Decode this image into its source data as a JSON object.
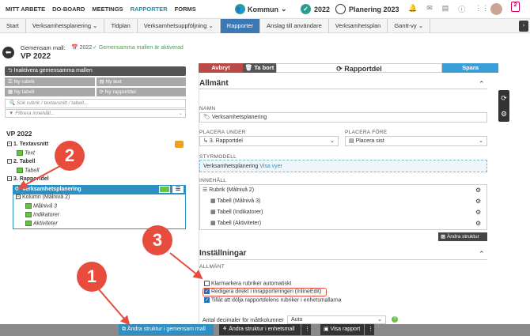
{
  "topnav": {
    "items": [
      "MITT ARBETE",
      "DO-BOARD",
      "MEETINGS",
      "RAPPORTER",
      "FORMS"
    ],
    "kommun": "Kommun",
    "year": "2022",
    "plan": "Planering 2023",
    "badge": "2"
  },
  "breadcrumbs": [
    "Start",
    "Verksamhetsplanering",
    "Tidplan",
    "Verksamhetsuppföljning",
    "Rapporter",
    "Anslag till användare",
    "Verksamhetsplan",
    "Gantt-vy"
  ],
  "header": {
    "label": "Gemensam mall:",
    "year": "2022",
    "status": "Gemensamma mallen är aktiverad",
    "title": "VP 2022"
  },
  "left": {
    "inaktivera": "Inaktivera gemensamma mallen",
    "buttons": [
      "Ny rubrik",
      "Ny text",
      "Ny tabell",
      "Ny rapportdel"
    ],
    "search_placeholder": "Sök rubrik / textavsnitt / tabell...",
    "filter_placeholder": "Filtrera innehåll..."
  },
  "tree": {
    "root": "VP 2022",
    "n1": "1. Textavsnitt",
    "n1c": "Text",
    "n2": "2. Tabell",
    "n2c": "Tabell",
    "n3": "3. Rapportdel",
    "sel": "Verksamhetsplanering",
    "kol": "Kolumn (Målnivå 2)",
    "m3": "Målnivå 3",
    "ind": "Indikatorer",
    "akt": "Aktiviteter"
  },
  "toolbar": {
    "avbryt": "Avbryt",
    "tabort": "Ta bort",
    "rapportdel": "Rapportdel",
    "spara": "Spara"
  },
  "allmant": {
    "title": "Allmänt",
    "namn_lbl": "NAMN",
    "namn": "Verksamhetsplanering",
    "placera_under_lbl": "PLACERA UNDER",
    "placera_under": "3. Rapportdel",
    "placera_fore_lbl": "PLACERA FÖRE",
    "placera_fore": "Placera sist",
    "styrmodell_lbl": "STYRMODELL",
    "styrmodell": "Verksamhetsplanering",
    "visa_vyer": "Visa vyer",
    "innehall_lbl": "INNEHÅLL",
    "innehall": [
      "Rubrik (Målnivå 2)",
      "Tabell (Målnivå 3)",
      "Tabell (Indikatorer)",
      "Tabell (Aktiviteter)"
    ],
    "andra_struktur": "Ändra struktur"
  },
  "installningar": {
    "title": "Inställningar",
    "allmant_lbl": "ALLMÄNT",
    "cb1": "Klarmarkera rubriker automatiskt",
    "cb2": "Redigera direkt i inrapporteringen (InlineEdit)",
    "cb3": "Tillåt att dölja rapportdelens rubriker i enhetsmallarna",
    "decimal_lbl": "Antal decimaler för måttkolumner",
    "decimal": "Auto"
  },
  "bottom": {
    "b1": "Ändra struktur i gemensam mall",
    "b2": "Ändra struktur i enhetsmall",
    "b3": "Visa rapport"
  },
  "annotations": [
    "1",
    "2",
    "3"
  ],
  "colors": {
    "accent": "#2d8fc2",
    "spara": "#3a9fd8",
    "avbryt": "#b94a48",
    "annotation": "#e74c3c"
  }
}
